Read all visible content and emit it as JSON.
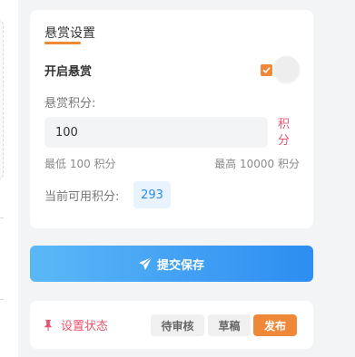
{
  "settings": {
    "title": "悬赏设置",
    "enable_label": "开启悬赏",
    "points_label": "悬赏积分:",
    "points_value": "100",
    "points_unit": "积分",
    "min_text": "最低 100 积分",
    "max_text": "最高 10000 积分",
    "available_label": "当前可用积分:",
    "available_value": "293",
    "enabled": true
  },
  "actions": {
    "submit_label": "提交保存",
    "submit_icon": "paper-plane-icon"
  },
  "status": {
    "label": "设置状态",
    "icon": "pin-icon",
    "options": [
      "待审核",
      "草稿",
      "发布"
    ],
    "selected": "发布"
  },
  "colors": {
    "accent_orange": "#f0883a",
    "danger_pink": "#e8556d",
    "info_blue": "#2f8be6",
    "gradient_start": "#5bb8f7",
    "gradient_end": "#2d8df1"
  }
}
